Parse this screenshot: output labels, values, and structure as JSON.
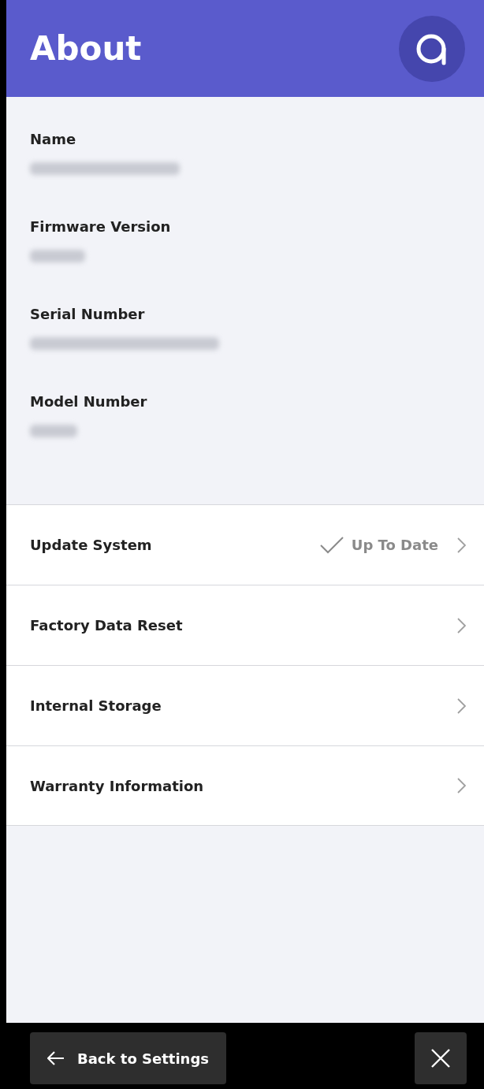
{
  "header": {
    "title": "About"
  },
  "info_fields": [
    {
      "label": "Name",
      "value_redacted": true
    },
    {
      "label": "Firmware Version",
      "value_redacted": true
    },
    {
      "label": "Serial Number",
      "value_redacted": true
    },
    {
      "label": "Model Number",
      "value_redacted": true
    }
  ],
  "menu": [
    {
      "label": "Update System",
      "status": "Up To Date"
    },
    {
      "label": "Factory Data Reset"
    },
    {
      "label": "Internal Storage"
    },
    {
      "label": "Warranty Information"
    }
  ],
  "footer": {
    "back_button": "Back to Settings"
  }
}
